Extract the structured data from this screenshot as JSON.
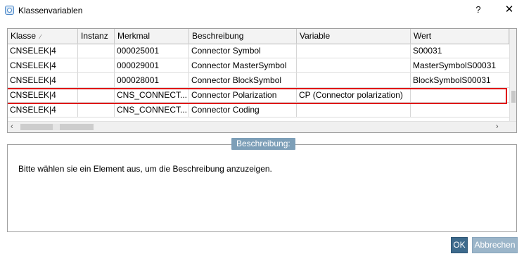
{
  "window": {
    "title": "Klassenvariablen",
    "help_label": "?",
    "close_label": "✕"
  },
  "table": {
    "columns": [
      "Klasse",
      "Instanz",
      "Merkmal",
      "Beschreibung",
      "Variable",
      "Wert"
    ],
    "rows": [
      [
        "CNSELEK|4",
        "",
        "000025001",
        "Connector Symbol",
        "",
        "S00031"
      ],
      [
        "CNSELEK|4",
        "",
        "000029001",
        "Connector MasterSymbol",
        "",
        "MasterSymbolS00031"
      ],
      [
        "CNSELEK|4",
        "",
        "000028001",
        "Connector BlockSymbol",
        "",
        "BlockSymbolS00031"
      ],
      [
        "CNSELEK|4",
        "",
        "CNS_CONNECT...",
        "Connector Polarization",
        "CP (Connector polarization)",
        ""
      ],
      [
        "CNSELEK|4",
        "",
        "CNS_CONNECT...",
        "Connector Coding",
        "",
        ""
      ]
    ],
    "highlighted_row": 3,
    "sort_column": "Klasse"
  },
  "description": {
    "legend": "Beschreibung:",
    "text": "Bitte wählen sie ein Element aus, um die Beschreibung anzuzeigen."
  },
  "buttons": {
    "ok": "OK",
    "cancel": "Abbrechen"
  },
  "colors": {
    "highlight_border": "#e01010",
    "primary_button": "#3d6a8c",
    "disabled_button": "#9bb5c9",
    "legend_bg": "#7d9fb8"
  }
}
